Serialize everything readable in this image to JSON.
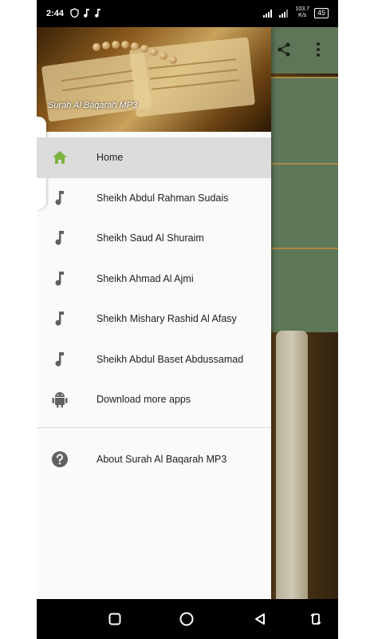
{
  "status_bar": {
    "time": "2:44",
    "speed_value": "103.7",
    "speed_unit": "K/s",
    "battery": "45"
  },
  "drawer": {
    "header_title": "Surah Al Baqarah MP3",
    "items": [
      {
        "label": "Home",
        "icon": "home-icon",
        "active": true
      },
      {
        "label": "Sheikh Abdul Rahman Sudais",
        "icon": "music-note-icon"
      },
      {
        "label": "Sheikh Saud Al Shuraim",
        "icon": "music-note-icon"
      },
      {
        "label": "Sheikh Ahmad Al Ajmi",
        "icon": "music-note-icon"
      },
      {
        "label": "Sheikh Mishary Rashid Al Afasy",
        "icon": "music-note-icon"
      },
      {
        "label": "Sheikh Abdul Baset Abdussamad",
        "icon": "music-note-icon"
      },
      {
        "label": "Download more apps",
        "icon": "android-icon"
      }
    ],
    "secondary_items": [
      {
        "label": "About Surah Al Baqarah MP3",
        "icon": "help-icon"
      }
    ]
  },
  "colors": {
    "home_icon": "#7cb342",
    "menu_icon": "#616161",
    "active_bg": "#dcdcdc",
    "toolbar": "#6f8a67"
  }
}
